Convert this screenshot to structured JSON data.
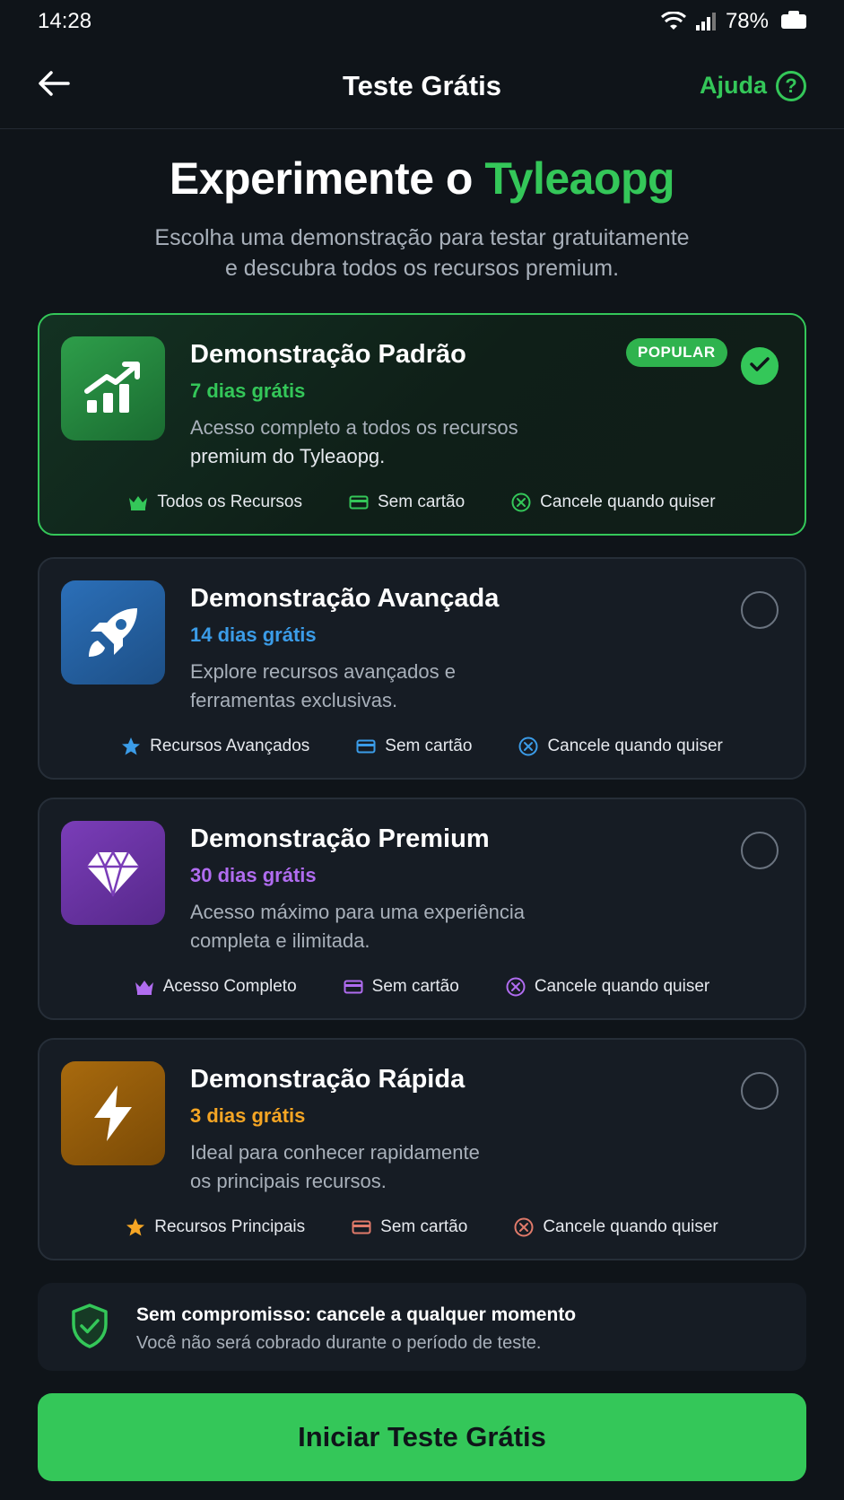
{
  "status_bar": {
    "time": "14:28",
    "battery": "78%"
  },
  "header": {
    "title": "Teste Grátis",
    "help_label": "Ajuda",
    "help_symbol": "?"
  },
  "hero": {
    "title_prefix": "Experimente o ",
    "brand": "Tyleaopg",
    "subtitle_line1": "Escolha uma demonstração para testar gratuitamente",
    "subtitle_line2": "e descubra todos os recursos premium."
  },
  "plans": [
    {
      "name": "Demonstração Padrão",
      "days": "7 dias grátis",
      "desc_line1": "Acesso completo a todos os recursos",
      "desc_line2": "premium do Tyleaopg.",
      "badge": "POPULAR",
      "selected": true,
      "icon": "chart-growth-icon",
      "accent": "#34c759",
      "features": [
        "Todos os Recursos",
        "Sem cartão",
        "Cancele quando quiser"
      ]
    },
    {
      "name": "Demonstração Avançada",
      "days": "14 dias grátis",
      "desc_line1": "Explore recursos avançados e",
      "desc_line2": "ferramentas exclusivas.",
      "selected": false,
      "icon": "rocket-icon",
      "accent": "#3b9ce8",
      "features": [
        "Recursos Avançados",
        "Sem cartão",
        "Cancele quando quiser"
      ]
    },
    {
      "name": "Demonstração Premium",
      "days": "30 dias grátis",
      "desc_line1": "Acesso máximo para uma experiência",
      "desc_line2": "completa e ilimitada.",
      "selected": false,
      "icon": "diamond-icon",
      "accent": "#b06cf0",
      "features": [
        "Acesso Completo",
        "Sem cartão",
        "Cancele quando quiser"
      ]
    },
    {
      "name": "Demonstração Rápida",
      "days": "3 dias grátis",
      "desc_line1": "Ideal para conhecer rapidamente",
      "desc_line2": "os principais recursos.",
      "selected": false,
      "icon": "lightning-icon",
      "accent": "#f5a524",
      "features": [
        "Recursos Principais",
        "Sem cartão",
        "Cancele quando quiser"
      ]
    }
  ],
  "guarantee": {
    "title": "Sem compromisso: cancele a qualquer momento",
    "subtitle": "Você não será cobrado durante o período de teste."
  },
  "cta": {
    "label": "Iniciar Teste Grátis"
  }
}
